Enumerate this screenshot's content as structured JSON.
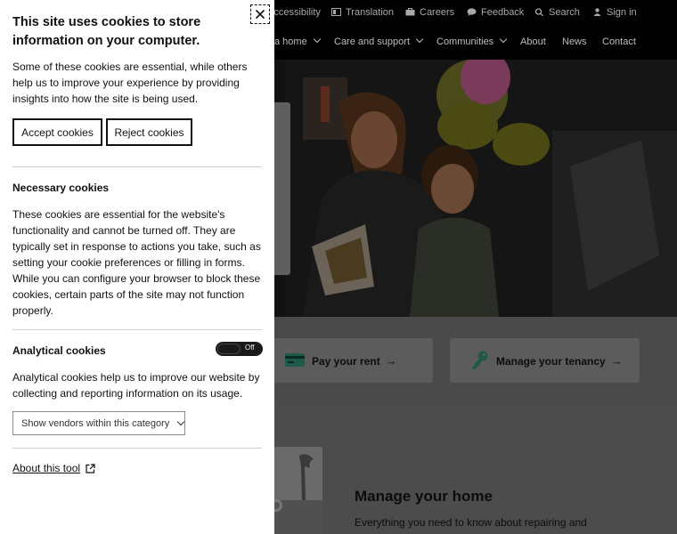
{
  "site": {
    "utility_nav": [
      {
        "label": "Accessibility",
        "icon": "accessibility-icon"
      },
      {
        "label": "Translation",
        "icon": "translation-icon"
      },
      {
        "label": "Careers",
        "icon": "briefcase-icon"
      },
      {
        "label": "Feedback",
        "icon": "speech-bubble-icon"
      },
      {
        "label": "Search",
        "icon": "search-icon"
      },
      {
        "label": "Sign in",
        "icon": "user-icon"
      }
    ],
    "main_nav": [
      {
        "label": "a home",
        "dropdown": true
      },
      {
        "label": "Care and support",
        "dropdown": true
      },
      {
        "label": "Communities",
        "dropdown": true
      },
      {
        "label": "About",
        "dropdown": false
      },
      {
        "label": "News",
        "dropdown": false
      },
      {
        "label": "Contact",
        "dropdown": false
      }
    ],
    "quick_links": [
      {
        "label": "Pay your rent",
        "icon": "card-icon"
      },
      {
        "label": "Manage your tenancy",
        "icon": "key-icon"
      }
    ],
    "feature": {
      "title": "Manage your home",
      "text": "Everything you need to know about repairing and"
    },
    "colors": {
      "accent": "#1e8a6e",
      "overlay_dark": "#000000"
    }
  },
  "cookie_panel": {
    "title": "This site uses cookies to store information on your computer.",
    "intro": "Some of these cookies are essential, while others help us to improve your experience by providing insights into how the site is being used.",
    "accept_label": "Accept cookies",
    "reject_label": "Reject cookies",
    "necessary": {
      "title": "Necessary cookies",
      "text": "These cookies are essential for the website's functionality and cannot be turned off. They are typically set in response to actions you take, such as setting your cookie preferences or filling in forms. While you can configure your browser to block these cookies, certain parts of the site may not function properly."
    },
    "analytical": {
      "title": "Analytical cookies",
      "toggle_state": "Off",
      "text": "Analytical cookies help us to improve our website by collecting and reporting information on its usage.",
      "vendors_label": "Show vendors within this category"
    },
    "about_label": "About this tool"
  }
}
